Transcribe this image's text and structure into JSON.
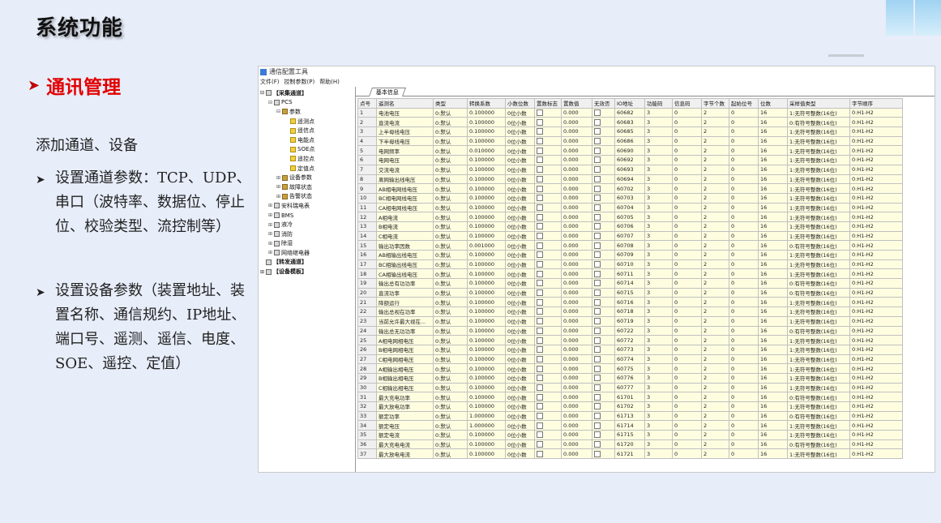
{
  "page": {
    "title": "系统功能"
  },
  "section": {
    "heading": "通讯管理"
  },
  "description": "添加通道、设备",
  "bullets": [
    "设置通道参数：TCP、UDP、串口（波特率、数据位、停止位、校验类型、流控制等）",
    "设置设备参数（装置地址、装置名称、通信规约、IP地址、端口号、遥测、遥信、电度、SOE、遥控、定值）"
  ],
  "window": {
    "title": "通信配置工具",
    "menu": [
      "文件(F)",
      "控制参数(P)",
      "帮助(H)"
    ],
    "tab": "基本信息"
  },
  "tree": [
    {
      "label": "【采集通道】",
      "level": 0,
      "icon": "channel-icon",
      "exp": "⊟",
      "bold": true
    },
    {
      "label": "PCS",
      "level": 1,
      "icon": "device-icon",
      "exp": "⊟",
      "bold": false
    },
    {
      "label": "参数",
      "level": 2,
      "icon": "folder-icon",
      "exp": "⊟",
      "bold": false
    },
    {
      "label": "遥测点",
      "level": 3,
      "icon": "telemetry-point-icon",
      "exp": "",
      "bold": false
    },
    {
      "label": "遥信点",
      "level": 3,
      "icon": "telesignal-point-icon",
      "exp": "",
      "bold": false
    },
    {
      "label": "电能点",
      "level": 3,
      "icon": "energy-point-icon",
      "exp": "",
      "bold": false
    },
    {
      "label": "SOE点",
      "level": 3,
      "icon": "soe-point-icon",
      "exp": "",
      "bold": false
    },
    {
      "label": "遥控点",
      "level": 3,
      "icon": "remote-control-point-icon",
      "exp": "",
      "bold": false
    },
    {
      "label": "定值点",
      "level": 3,
      "icon": "setpoint-icon",
      "exp": "",
      "bold": false
    },
    {
      "label": "设备参数",
      "level": 2,
      "icon": "folder-icon",
      "exp": "⊞",
      "bold": false
    },
    {
      "label": "故障状态",
      "level": 2,
      "icon": "folder-icon",
      "exp": "⊞",
      "bold": false
    },
    {
      "label": "告警状态",
      "level": 2,
      "icon": "folder-icon",
      "exp": "⊞",
      "bold": false
    },
    {
      "label": "安科瑞电表",
      "level": 1,
      "icon": "device-icon",
      "exp": "⊞",
      "bold": false
    },
    {
      "label": "BMS",
      "level": 1,
      "icon": "device-icon",
      "exp": "⊞",
      "bold": false
    },
    {
      "label": "液冷",
      "level": 1,
      "icon": "device-icon",
      "exp": "⊞",
      "bold": false
    },
    {
      "label": "消防",
      "level": 1,
      "icon": "device-icon",
      "exp": "⊞",
      "bold": false
    },
    {
      "label": "除湿",
      "level": 1,
      "icon": "device-icon",
      "exp": "⊞",
      "bold": false
    },
    {
      "label": "网络继电器",
      "level": 1,
      "icon": "device-icon",
      "exp": "⊞",
      "bold": false
    },
    {
      "label": "【转发通道】",
      "level": 0,
      "icon": "channel-icon",
      "exp": "",
      "bold": true
    },
    {
      "label": "【设备模板】",
      "level": 0,
      "icon": "channel-icon",
      "exp": "⊞",
      "bold": true
    }
  ],
  "columns": [
    "点号",
    "遥测名",
    "类型",
    "转换系数",
    "小数位数",
    "置数标志",
    "置数值",
    "无效否",
    "IO地址",
    "功能码",
    "信息码",
    "字节个数",
    "起始位号",
    "位数",
    "采样值类型",
    "字节顺序"
  ],
  "rows": [
    [
      "1",
      "电池电压",
      "0:默认",
      "0.100000",
      "0位小数",
      "",
      "0.000",
      "",
      "60682",
      "3",
      "0",
      "2",
      "0",
      "16",
      "1:无符号整数(16位)",
      "0:H1-H2"
    ],
    [
      "2",
      "直流电流",
      "0:默认",
      "0.100000",
      "0位小数",
      "",
      "0.000",
      "",
      "60683",
      "3",
      "0",
      "2",
      "0",
      "16",
      "0:有符号整数(16位)",
      "0:H1-H2"
    ],
    [
      "3",
      "上半母线电压",
      "0:默认",
      "0.100000",
      "0位小数",
      "",
      "0.000",
      "",
      "60685",
      "3",
      "0",
      "2",
      "0",
      "16",
      "1:无符号整数(16位)",
      "0:H1-H2"
    ],
    [
      "4",
      "下半母线电压",
      "0:默认",
      "0.100000",
      "0位小数",
      "",
      "0.000",
      "",
      "60686",
      "3",
      "0",
      "2",
      "0",
      "16",
      "1:无符号整数(16位)",
      "0:H1-H2"
    ],
    [
      "5",
      "电网频率",
      "0:默认",
      "0.010000",
      "0位小数",
      "",
      "0.000",
      "",
      "60690",
      "3",
      "0",
      "2",
      "0",
      "16",
      "1:无符号整数(16位)",
      "0:H1-H2"
    ],
    [
      "6",
      "电网电压",
      "0:默认",
      "0.100000",
      "0位小数",
      "",
      "0.000",
      "",
      "60692",
      "3",
      "0",
      "2",
      "0",
      "16",
      "1:无符号整数(16位)",
      "0:H1-H2"
    ],
    [
      "7",
      "交流电流",
      "0:默认",
      "0.100000",
      "0位小数",
      "",
      "0.000",
      "",
      "60693",
      "3",
      "0",
      "2",
      "0",
      "16",
      "1:无符号整数(16位)",
      "0:H1-H2"
    ],
    [
      "8",
      "离网输出线电压",
      "0:默认",
      "0.100000",
      "0位小数",
      "",
      "0.000",
      "",
      "60694",
      "3",
      "0",
      "2",
      "0",
      "16",
      "1:无符号整数(16位)",
      "0:H1-H2"
    ],
    [
      "9",
      "AB相电网线电压",
      "0:默认",
      "0.100000",
      "0位小数",
      "",
      "0.000",
      "",
      "60702",
      "3",
      "0",
      "2",
      "0",
      "16",
      "1:无符号整数(16位)",
      "0:H1-H2"
    ],
    [
      "10",
      "BC相电网线电压",
      "0:默认",
      "0.100000",
      "0位小数",
      "",
      "0.000",
      "",
      "60703",
      "3",
      "0",
      "2",
      "0",
      "16",
      "1:无符号整数(16位)",
      "0:H1-H2"
    ],
    [
      "11",
      "CA相电网线电压",
      "0:默认",
      "0.100000",
      "0位小数",
      "",
      "0.000",
      "",
      "60704",
      "3",
      "0",
      "2",
      "0",
      "16",
      "1:无符号整数(16位)",
      "0:H1-H2"
    ],
    [
      "12",
      "A相电流",
      "0:默认",
      "0.100000",
      "0位小数",
      "",
      "0.000",
      "",
      "60705",
      "3",
      "0",
      "2",
      "0",
      "16",
      "1:无符号整数(16位)",
      "0:H1-H2"
    ],
    [
      "13",
      "B相电流",
      "0:默认",
      "0.100000",
      "0位小数",
      "",
      "0.000",
      "",
      "60706",
      "3",
      "0",
      "2",
      "0",
      "16",
      "1:无符号整数(16位)",
      "0:H1-H2"
    ],
    [
      "14",
      "C相电流",
      "0:默认",
      "0.100000",
      "0位小数",
      "",
      "0.000",
      "",
      "60707",
      "3",
      "0",
      "2",
      "0",
      "16",
      "1:无符号整数(16位)",
      "0:H1-H2"
    ],
    [
      "15",
      "输出功率因数",
      "0:默认",
      "0.001000",
      "0位小数",
      "",
      "0.000",
      "",
      "60708",
      "3",
      "0",
      "2",
      "0",
      "16",
      "0:有符号整数(16位)",
      "0:H1-H2"
    ],
    [
      "16",
      "AB相输出线电压",
      "0:默认",
      "0.100000",
      "0位小数",
      "",
      "0.000",
      "",
      "60709",
      "3",
      "0",
      "2",
      "0",
      "16",
      "1:无符号整数(16位)",
      "0:H1-H2"
    ],
    [
      "17",
      "BC相输出线电压",
      "0:默认",
      "0.100000",
      "0位小数",
      "",
      "0.000",
      "",
      "60710",
      "3",
      "0",
      "2",
      "0",
      "16",
      "1:无符号整数(16位)",
      "0:H1-H2"
    ],
    [
      "18",
      "CA相输出线电压",
      "0:默认",
      "0.100000",
      "0位小数",
      "",
      "0.000",
      "",
      "60711",
      "3",
      "0",
      "2",
      "0",
      "16",
      "1:无符号整数(16位)",
      "0:H1-H2"
    ],
    [
      "19",
      "输出总有功功率",
      "0:默认",
      "0.100000",
      "0位小数",
      "",
      "0.000",
      "",
      "60714",
      "3",
      "0",
      "2",
      "0",
      "16",
      "0:有符号整数(16位)",
      "0:H1-H2"
    ],
    [
      "20",
      "直流功率",
      "0:默认",
      "0.100000",
      "0位小数",
      "",
      "0.000",
      "",
      "60715",
      "3",
      "0",
      "2",
      "0",
      "16",
      "0:有符号整数(16位)",
      "0:H1-H2"
    ],
    [
      "21",
      "降额运行",
      "0:默认",
      "0.100000",
      "0位小数",
      "",
      "0.000",
      "",
      "60716",
      "3",
      "0",
      "2",
      "0",
      "16",
      "1:无符号整数(16位)",
      "0:H1-H2"
    ],
    [
      "22",
      "输出总视在功率",
      "0:默认",
      "0.100000",
      "0位小数",
      "",
      "0.000",
      "",
      "60718",
      "3",
      "0",
      "2",
      "0",
      "16",
      "1:无符号整数(16位)",
      "0:H1-H2"
    ],
    [
      "23",
      "当前允许最大视在...",
      "0:默认",
      "0.100000",
      "0位小数",
      "",
      "0.000",
      "",
      "60719",
      "3",
      "0",
      "2",
      "0",
      "16",
      "1:无符号整数(16位)",
      "0:H1-H2"
    ],
    [
      "24",
      "输出总无功功率",
      "0:默认",
      "0.100000",
      "0位小数",
      "",
      "0.000",
      "",
      "60722",
      "3",
      "0",
      "2",
      "0",
      "16",
      "0:有符号整数(16位)",
      "0:H1-H2"
    ],
    [
      "25",
      "A相电网相电压",
      "0:默认",
      "0.100000",
      "0位小数",
      "",
      "0.000",
      "",
      "60772",
      "3",
      "0",
      "2",
      "0",
      "16",
      "1:无符号整数(16位)",
      "0:H1-H2"
    ],
    [
      "26",
      "B相电网相电压",
      "0:默认",
      "0.100000",
      "0位小数",
      "",
      "0.000",
      "",
      "60773",
      "3",
      "0",
      "2",
      "0",
      "16",
      "1:无符号整数(16位)",
      "0:H1-H2"
    ],
    [
      "27",
      "C相电网相电压",
      "0:默认",
      "0.100000",
      "0位小数",
      "",
      "0.000",
      "",
      "60774",
      "3",
      "0",
      "2",
      "0",
      "16",
      "1:无符号整数(16位)",
      "0:H1-H2"
    ],
    [
      "28",
      "A相输出相电压",
      "0:默认",
      "0.100000",
      "0位小数",
      "",
      "0.000",
      "",
      "60775",
      "3",
      "0",
      "2",
      "0",
      "16",
      "1:无符号整数(16位)",
      "0:H1-H2"
    ],
    [
      "29",
      "B相输出相电压",
      "0:默认",
      "0.100000",
      "0位小数",
      "",
      "0.000",
      "",
      "60776",
      "3",
      "0",
      "2",
      "0",
      "16",
      "1:无符号整数(16位)",
      "0:H1-H2"
    ],
    [
      "30",
      "C相输出相电压",
      "0:默认",
      "0.100000",
      "0位小数",
      "",
      "0.000",
      "",
      "60777",
      "3",
      "0",
      "2",
      "0",
      "16",
      "1:无符号整数(16位)",
      "0:H1-H2"
    ],
    [
      "31",
      "最大充电功率",
      "0:默认",
      "0.100000",
      "0位小数",
      "",
      "0.000",
      "",
      "61701",
      "3",
      "0",
      "2",
      "0",
      "16",
      "0:有符号整数(16位)",
      "0:H1-H2"
    ],
    [
      "32",
      "最大放电功率",
      "0:默认",
      "0.100000",
      "0位小数",
      "",
      "0.000",
      "",
      "61702",
      "3",
      "0",
      "2",
      "0",
      "16",
      "1:无符号整数(16位)",
      "0:H1-H2"
    ],
    [
      "33",
      "额定功率",
      "0:默认",
      "1.000000",
      "0位小数",
      "",
      "0.000",
      "",
      "61713",
      "3",
      "0",
      "2",
      "0",
      "16",
      "0:有符号整数(16位)",
      "0:H1-H2"
    ],
    [
      "34",
      "额定电压",
      "0:默认",
      "1.000000",
      "0位小数",
      "",
      "0.000",
      "",
      "61714",
      "3",
      "0",
      "2",
      "0",
      "16",
      "1:无符号整数(16位)",
      "0:H1-H2"
    ],
    [
      "35",
      "额定电流",
      "0:默认",
      "0.100000",
      "0位小数",
      "",
      "0.000",
      "",
      "61715",
      "3",
      "0",
      "2",
      "0",
      "16",
      "1:无符号整数(16位)",
      "0:H1-H2"
    ],
    [
      "36",
      "最大充电电流",
      "0:默认",
      "0.100000",
      "0位小数",
      "",
      "0.000",
      "",
      "61720",
      "3",
      "0",
      "2",
      "0",
      "16",
      "0:有符号整数(16位)",
      "0:H1-H2"
    ],
    [
      "37",
      "最大放电电流",
      "0:默认",
      "0.100000",
      "0位小数",
      "",
      "0.000",
      "",
      "61721",
      "3",
      "0",
      "2",
      "0",
      "16",
      "1:无符号整数(16位)",
      "0:H1-H2"
    ]
  ],
  "colors": {
    "accent_red": "#e20000",
    "grid_cell_bg": "#fffde0",
    "page_bg": "#e7edf9"
  }
}
